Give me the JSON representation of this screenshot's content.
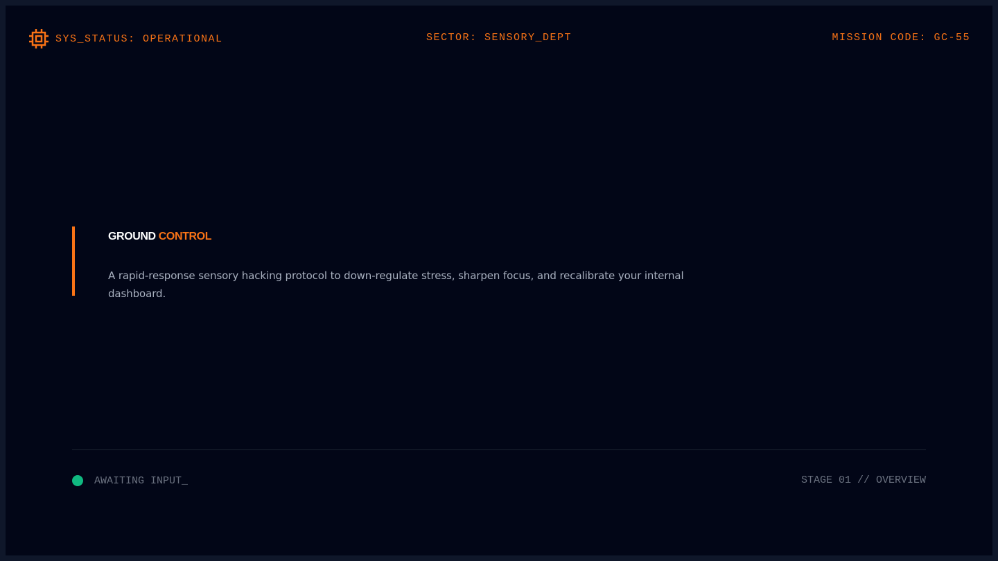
{
  "header": {
    "icon": "cpu-chip-icon",
    "status": "SYS_STATUS: OPERATIONAL",
    "sector": "SECTOR: SENSORY_DEPT",
    "mission": "MISSION CODE: GC-55"
  },
  "hero": {
    "title_part1": "GROUND",
    "title_part2": "CONTROL",
    "description": "A rapid-response sensory hacking protocol to down-regulate stress, sharpen focus, and recalibrate your internal dashboard."
  },
  "footer": {
    "status_text": "AWAITING INPUT_",
    "stage": "STAGE 01 // OVERVIEW"
  },
  "colors": {
    "background": "#020617",
    "frame": "#0f172a",
    "accent": "#f97316",
    "status_ok": "#10b981",
    "muted": "#6b7280"
  }
}
